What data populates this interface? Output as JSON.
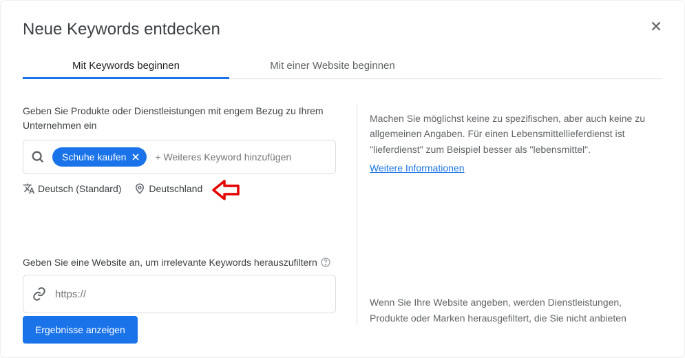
{
  "title": "Neue Keywords entdecken",
  "tabs": {
    "keywords": "Mit Keywords beginnen",
    "website": "Mit einer Website beginnen"
  },
  "section1": {
    "label": "Geben Sie Produkte oder Dienstleistungen mit engem Bezug zu Ihrem Unternehmen ein",
    "chip": "Schuhe kaufen",
    "placeholder": "+ Weiteres Keyword hinzufügen"
  },
  "langloc": {
    "language": "Deutsch (Standard)",
    "location": "Deutschland"
  },
  "help1": {
    "text": "Machen Sie möglichst keine zu spezifischen, aber auch keine zu allgemeinen Angaben. Für einen Lebensmittellieferdienst ist \"lieferdienst\" zum Beispiel besser als \"lebensmittel\".",
    "link": "Weitere Informationen"
  },
  "section2": {
    "label": "Geben Sie eine Website an, um irrelevante Keywords herauszufiltern",
    "placeholder": "https://"
  },
  "help2": {
    "text": "Wenn Sie Ihre Website angeben, werden Dienstleistungen, Produkte oder Marken herausgefiltert, die Sie nicht anbieten"
  },
  "button": "Ergebnisse anzeigen"
}
